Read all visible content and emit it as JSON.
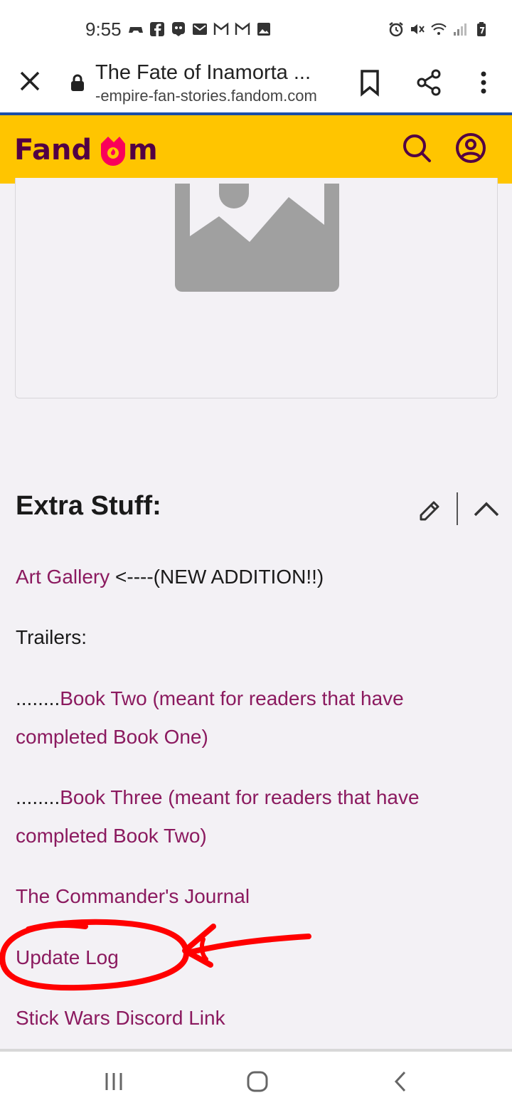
{
  "status_bar": {
    "time": "9:55"
  },
  "url_bar": {
    "page_title": "The Fate of Inamorta ...",
    "host": "-empire-fan-stories.fandom.com"
  },
  "header": {
    "logo_text": "Fandom",
    "accent_color": "#ffc500",
    "logo_color": "#520044"
  },
  "section": {
    "title": "Extra Stuff:"
  },
  "content": {
    "art_gallery_link": "Art Gallery",
    "art_gallery_note": " <----(NEW ADDITION!!)",
    "trailers_label": "Trailers:",
    "book_two_prefix": "........",
    "book_two_link_line1": "Book Two (meant for readers that have",
    "book_two_link_line2": "completed Book One)",
    "book_three_prefix": "........",
    "book_three_link_line1": "Book Three (meant for readers that have",
    "book_three_link_line2": "completed Book Two)",
    "journal_link": "The Commander's Journal",
    "update_log_link": "Update Log",
    "discord_link": "Stick Wars Discord Link"
  },
  "colors": {
    "link": "#8b1a5f",
    "annotation": "#ff0000"
  }
}
